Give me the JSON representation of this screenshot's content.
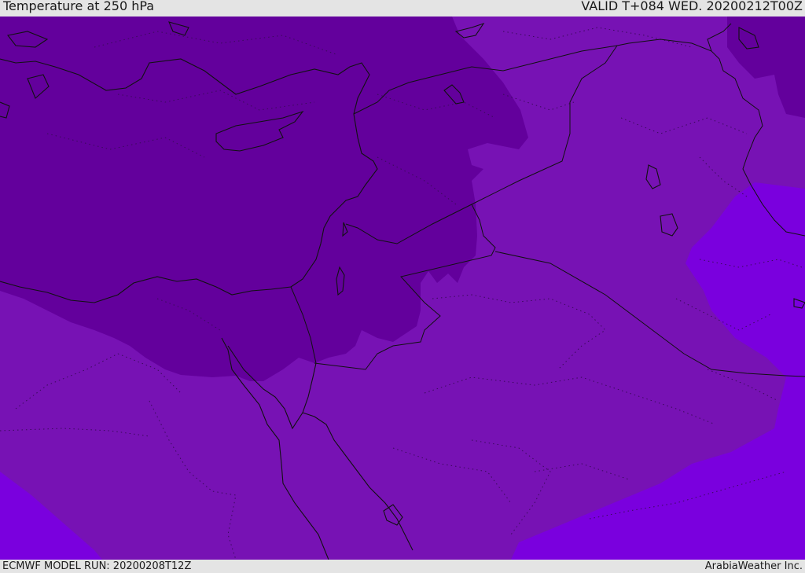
{
  "header": {
    "title": "Temperature at 250 hPa",
    "valid": "VALID T+084 WED. 20200212T00Z"
  },
  "footer": {
    "model_run": "ECMWF MODEL RUN: 20200208T12Z",
    "credit": "ArabiaWeather Inc."
  },
  "colors": {
    "dark": "#63009c",
    "mid": "#7712b4",
    "light": "#7a00de",
    "border": "#111111"
  },
  "icons": [
    "temperature-map",
    "coastline",
    "country-borders"
  ]
}
